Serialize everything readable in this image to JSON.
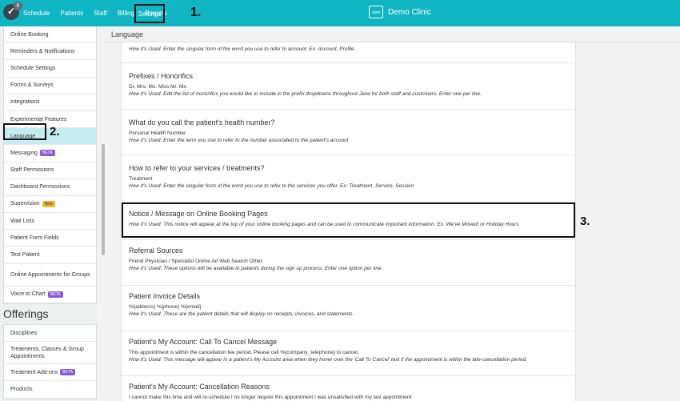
{
  "topbar": {
    "logo_badge": "6",
    "nav": [
      "Schedule",
      "Patients",
      "Staff",
      "Billing",
      "Reports"
    ],
    "settings_label": "Settings",
    "clinic_icon_text": "Jane",
    "clinic_name": "Demo Clinic",
    "colors": {
      "bar": "#0fb5c2"
    }
  },
  "annotations": {
    "one": "1.",
    "two": "2.",
    "three": "3."
  },
  "sidebar": {
    "items": [
      {
        "label": "Online Booking"
      },
      {
        "label": "Reminders & Notifications"
      },
      {
        "label": "Schedule Settings"
      },
      {
        "label": "Forms & Surveys"
      },
      {
        "label": "Integrations"
      },
      {
        "label": "Experimental Features"
      },
      {
        "label": "Language"
      },
      {
        "label": "Messaging",
        "badge": "BETA"
      },
      {
        "label": "Staff Permissions"
      },
      {
        "label": "Dashboard Permissions"
      },
      {
        "label": "Supervision",
        "badge": "New"
      },
      {
        "label": "Wait Lists"
      },
      {
        "label": "Patient Form Fields"
      },
      {
        "label": "Test Patient"
      },
      {
        "label": "Online Appointments for Groups"
      },
      {
        "label": "Voice to Chart",
        "badge": "BETA"
      }
    ],
    "offerings_heading": "Offerings",
    "offerings": [
      {
        "label": "Disciplines"
      },
      {
        "label": "Treatments, Classes & Group Appointments"
      },
      {
        "label": "Treatment Add-ons",
        "badge": "BETA"
      },
      {
        "label": "Products"
      }
    ]
  },
  "main": {
    "title": "Language",
    "sections": [
      {
        "title": "",
        "value": "",
        "help": "How it's Used: Enter the singular form of the word you use to refer to account. Ex: Account, Profile"
      },
      {
        "title": "Prefixes / Honorifics",
        "value": "Dr. Mrs. Ms. Miss Mr. Mx.",
        "help": "How it's Used: Edit the list of honorifics you would like to include in the prefix dropdowns throughout Jane for both staff and customers. Enter one per line."
      },
      {
        "title": "What do you call the patient's health number?",
        "value": "Personal Health Number",
        "help": "How it's Used: Enter the term you use to refer to the number associated to the patient's account"
      },
      {
        "title": "How to refer to your services / treatments?",
        "value": "Treatment",
        "help": "How it's Used: Enter the singular form of the word you use to refer to the services you offer. Ex: Treatment, Service, Session"
      },
      {
        "title": "Notice / Message on Online Booking Pages",
        "value": "",
        "help": "How it's Used: This notice will appear at the top of your online booking pages and can be used to communicate important information. Ex. We've Moved! or Holiday Hours"
      },
      {
        "title": "Referral Sources",
        "value": "Friend Physician / Specialist Online Ad Web Search Other",
        "help": "How it's Used: These options will be available to patients during the sign up process. Enter one option per line."
      },
      {
        "title": "Patient Invoice Details",
        "value": "%{address} %{phone} %{email}",
        "help": "How it's Used: These are the patient details that will display on receipts, invoices, and statements."
      },
      {
        "title": "Patient's My Account: Call To Cancel Message",
        "value": "This appointment is within the cancellation fee period. Please call %{company_telephone} to cancel.",
        "help": "How it's Used: This message will appear in a patient's My Account area when they hover over the 'Call To Cancel' text if the appointment is within the late-cancellation period."
      },
      {
        "title": "Patient's My Account: Cancellation Reasons",
        "value": "I cannot make this time and will re-schedule I no longer require this appointment I was unsatisfied with my last appointment",
        "help": ""
      }
    ]
  }
}
